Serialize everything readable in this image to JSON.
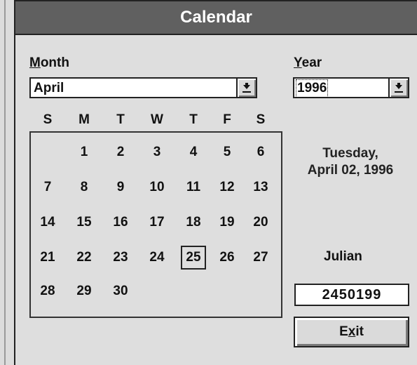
{
  "window": {
    "title": "Calendar"
  },
  "month": {
    "label_prefix": "M",
    "label_rest": "onth",
    "value": "April"
  },
  "year": {
    "label_prefix": "Y",
    "label_rest": "ear",
    "value": "1996"
  },
  "weekdays": [
    "S",
    "M",
    "T",
    "W",
    "T",
    "F",
    "S"
  ],
  "calendar": {
    "first_weekday_index": 1,
    "days": [
      "1",
      "2",
      "3",
      "4",
      "5",
      "6",
      "7",
      "8",
      "9",
      "10",
      "11",
      "12",
      "13",
      "14",
      "15",
      "16",
      "17",
      "18",
      "19",
      "20",
      "21",
      "22",
      "23",
      "24",
      "25",
      "26",
      "27",
      "28",
      "29",
      "30"
    ],
    "selected_day": "25"
  },
  "date_display": {
    "line1": "Tuesday,",
    "line2": "April 02, 1996"
  },
  "julian": {
    "label": "Julian",
    "value": "2450199"
  },
  "exit_button": {
    "label_prefix": "E",
    "label_mnemonic": "x",
    "label_rest": "it"
  },
  "icons": {
    "dropdown": "dropdown-arrow-icon"
  }
}
